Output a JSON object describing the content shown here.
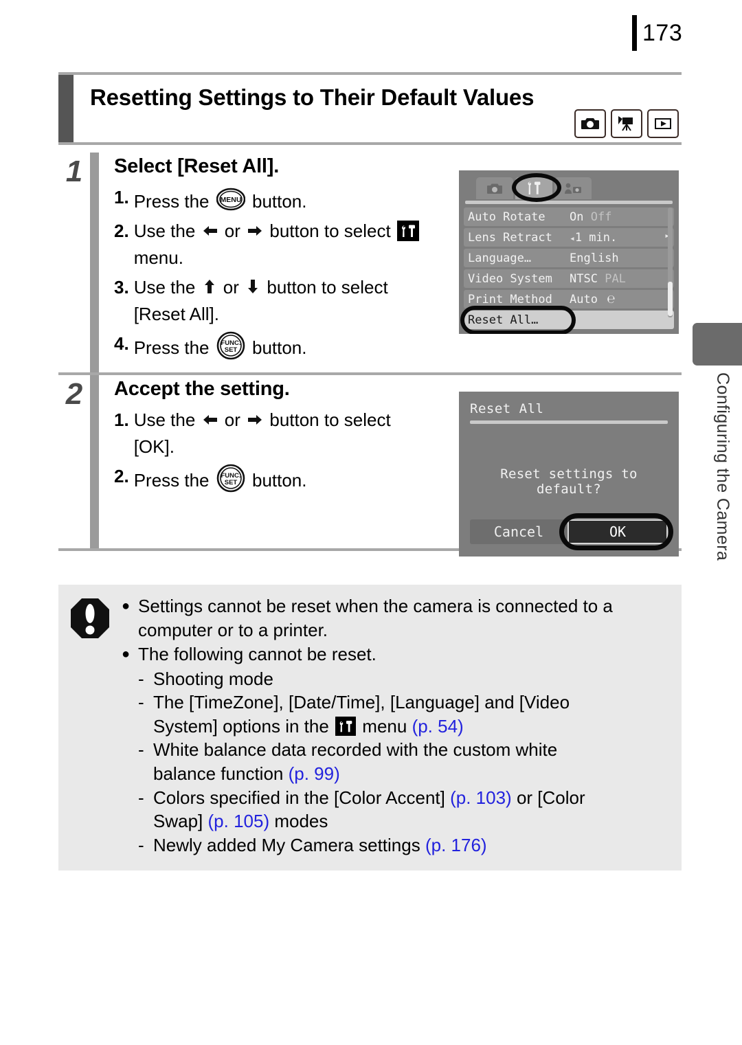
{
  "page": {
    "number": "173",
    "side_tab_label": "Configuring the Camera"
  },
  "header": {
    "title": "Resetting Settings to Their Default Values",
    "mode_icons": [
      "still-camera-icon",
      "movie-camera-icon",
      "playback-icon"
    ]
  },
  "steps": [
    {
      "number": "1",
      "heading": "Select [Reset All].",
      "items": [
        {
          "num": "1.",
          "line1_pre": "Press the",
          "icon": "menu-button-icon",
          "line1_post": "button."
        },
        {
          "num": "2.",
          "line1_pre": "Use the",
          "left_arrow": "⬅",
          "or": "or",
          "right_arrow": "➡",
          "line1_mid": "button to select",
          "icon": "tools-menu-icon",
          "line2": "menu."
        },
        {
          "num": "3.",
          "line1_pre": "Use the",
          "up_arrow": "⬆",
          "or": "or",
          "down_arrow": "⬇",
          "line1_mid": "button to select",
          "line2": "[Reset All]."
        },
        {
          "num": "4.",
          "line1_pre": "Press the",
          "icon": "func-set-button-icon",
          "line1_post": "button."
        }
      ]
    },
    {
      "number": "2",
      "heading": "Accept the setting.",
      "items": [
        {
          "num": "1.",
          "line1_pre": "Use the",
          "left_arrow": "⬅",
          "or": "or",
          "right_arrow": "➡",
          "line1_mid": "button to select",
          "line2": "[OK]."
        },
        {
          "num": "2.",
          "line1_pre": "Press the",
          "icon": "func-set-button-icon",
          "line1_post": "button."
        }
      ]
    }
  ],
  "camera_menu": {
    "tabs": [
      {
        "name": "shooting-tab",
        "icon": "camera-icon",
        "active": false
      },
      {
        "name": "setup-tab",
        "icon": "tools-icon",
        "active": true
      },
      {
        "name": "my-camera-tab",
        "icon": "my-camera-icon",
        "active": false
      }
    ],
    "rows": [
      {
        "label": "Auto Rotate",
        "value": "On",
        "value_dim": "Off",
        "selected": false
      },
      {
        "label": "Lens Retract",
        "value": "1 min.",
        "value_dim": "",
        "arrows": true,
        "selected": false
      },
      {
        "label": "Language…",
        "value": "English",
        "value_dim": "",
        "selected": false
      },
      {
        "label": "Video System",
        "value": "NTSC",
        "value_dim": "PAL",
        "selected": false
      },
      {
        "label": "Print Method",
        "value": "Auto",
        "value_dim": "",
        "icon": "printer-mark",
        "selected": false
      },
      {
        "label": "Reset All…",
        "value": "",
        "value_dim": "",
        "selected": true
      }
    ]
  },
  "camera_dialog": {
    "title": "Reset All",
    "message": "Reset settings to default?",
    "cancel_label": "Cancel",
    "ok_label": "OK"
  },
  "note": {
    "icon": "warning-octagon-icon",
    "bullets": [
      {
        "lines": [
          "Settings cannot be reset when the camera is connected to a",
          "computer or to a printer."
        ]
      },
      {
        "lines": [
          "The following cannot be reset."
        ],
        "dashes": [
          {
            "lines": [
              "Shooting mode"
            ]
          },
          {
            "lines": [
              "The [TimeZone], [Date/Time], [Language] and [Video"
            ],
            "line2_pre": "System] options in the",
            "inline_icon": "tools-menu-icon",
            "line2_mid": "menu",
            "ref": "(p. 54)"
          },
          {
            "lines": [
              "White balance data recorded with the custom white"
            ],
            "line2_pre": "balance function",
            "ref": "(p. 99)"
          },
          {
            "line1_pre": "Colors specified in the [Color Accent]",
            "ref1": "(p. 103)",
            "line1_post": "or [Color",
            "line2_pre": "Swap]",
            "ref": "(p. 105)",
            "line2_post": "modes"
          },
          {
            "line1_pre": "Newly added My Camera settings",
            "ref1": "(p. 176)"
          }
        ]
      }
    ]
  },
  "colors": {
    "link": "#2222dd",
    "rule": "#a8a8a8",
    "step_bar": "#9b9b9b",
    "title_bar": "#555555",
    "note_bg": "#e9e9e9",
    "screen_bg": "#7d7d7d"
  }
}
